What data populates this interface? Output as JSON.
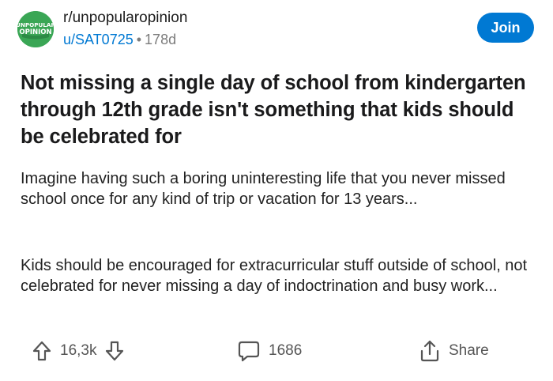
{
  "community": {
    "name": "r/unpopularopinion",
    "avatar_text_top": "UNPOPULAR",
    "avatar_text_bottom": "OPINION",
    "avatar_color": "#3aa655"
  },
  "author": {
    "username": "u/SAT0725",
    "separator": "•",
    "age": "178d"
  },
  "join_label": "Join",
  "post": {
    "title": "Not missing a single day of school from kindergarten through 12th grade isn't something that kids should be celebrated for",
    "body": [
      "Imagine having such a boring uninteresting life that you never missed school once for any kind of trip or vacation for 13 years...",
      "Kids should be encouraged for extracurricular stuff outside of school, not celebrated for never missing a day of indoctrination and busy work..."
    ]
  },
  "actions": {
    "upvote_icon": "arrow-up-icon",
    "vote_count": "16,3k",
    "downvote_icon": "arrow-down-icon",
    "comment_icon": "comment-bubble-icon",
    "comment_count": "1686",
    "share_icon": "share-icon",
    "share_label": "Share"
  },
  "colors": {
    "accent": "#0079d3",
    "muted": "#7c7c7c"
  }
}
